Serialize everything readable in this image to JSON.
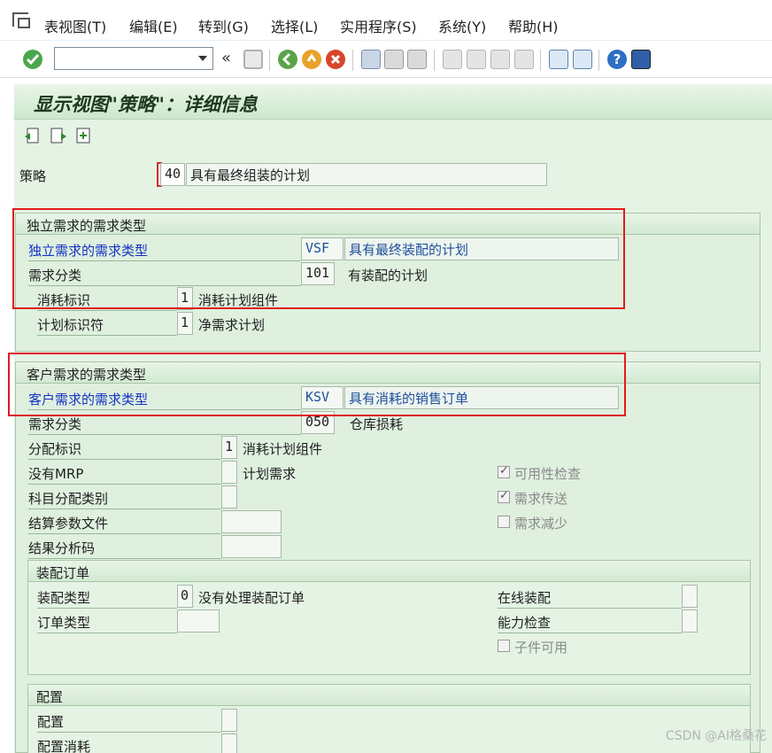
{
  "menu": [
    {
      "label": "表视图(T)"
    },
    {
      "label": "编辑(E)"
    },
    {
      "label": "转到(G)"
    },
    {
      "label": "选择(L)"
    },
    {
      "label": "实用程序(S)"
    },
    {
      "label": "系统(Y)"
    },
    {
      "label": "帮助(H)"
    }
  ],
  "toolbar": {
    "command_value": "",
    "icons": [
      "check-icon",
      "back-nav-icon",
      "save-icon",
      "back-icon",
      "exit-icon",
      "cancel-icon",
      "print-icon",
      "find-icon",
      "find-next-icon",
      "first-page-icon",
      "prev-page-icon",
      "next-page-icon",
      "last-page-icon",
      "new-session-icon",
      "shortcut-icon",
      "help-icon",
      "layout-icon"
    ]
  },
  "screen": {
    "title": "显示视图\"策略\"：详细信息"
  },
  "strategy": {
    "label": "策略",
    "code": "40",
    "desc": "具有最终组装的计划"
  },
  "indep": {
    "header": "独立需求的需求类型",
    "type_label": "独立需求的需求类型",
    "type_code": "VSF",
    "type_desc": "具有最终装配的计划",
    "class_label": "需求分类",
    "class_code": "101",
    "class_desc": "有装配的计划",
    "consume_label": "消耗标识",
    "consume_code": "1",
    "consume_desc": "消耗计划组件",
    "plan_label": "计划标识符",
    "plan_code": "1",
    "plan_desc": "净需求计划"
  },
  "cust": {
    "header": "客户需求的需求类型",
    "type_label": "客户需求的需求类型",
    "type_code": "KSV",
    "type_desc": "具有消耗的销售订单",
    "class_label": "需求分类",
    "class_code": "050",
    "class_desc": "仓库损耗",
    "alloc_label": "分配标识",
    "alloc_code": "1",
    "alloc_desc": "消耗计划组件",
    "nomrp_label": "没有MRP",
    "nomrp_desc": "计划需求",
    "acct_label": "科目分配类别",
    "settle_label": "结算参数文件",
    "result_label": "结果分析码",
    "avail_label": "可用性检查",
    "transfer_label": "需求传送",
    "reduce_label": "需求减少"
  },
  "assembly": {
    "header": "装配订单",
    "type_label": "装配类型",
    "type_code": "0",
    "type_desc": "没有处理装配订单",
    "order_label": "订单类型",
    "online_label": "在线装配",
    "capacity_label": "能力检查",
    "component_label": "子件可用"
  },
  "config": {
    "header": "配置",
    "config_label": "配置",
    "consume_label": "配置消耗"
  },
  "watermark": "CSDN @AI格桑花"
}
